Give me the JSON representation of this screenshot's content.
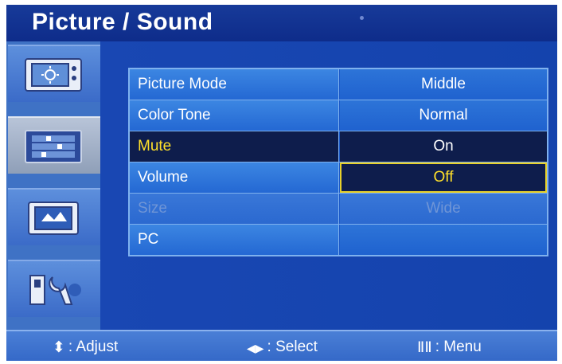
{
  "title": "Picture / Sound",
  "sidebar": {
    "items": [
      {
        "icon": "picture-icon"
      },
      {
        "icon": "audio-settings-icon"
      },
      {
        "icon": "screen-size-icon"
      },
      {
        "icon": "setup-tools-icon"
      }
    ],
    "selected_index": 1
  },
  "menu": {
    "rows": [
      {
        "label": "Picture Mode",
        "value": "Middle"
      },
      {
        "label": "Color Tone",
        "value": "Normal"
      },
      {
        "label": "Mute",
        "value": "On"
      },
      {
        "label": "Volume",
        "value": "Off"
      },
      {
        "label": "Size",
        "value": "Wide"
      },
      {
        "label": "PC",
        "value": ""
      }
    ]
  },
  "footer": {
    "adjust_label": ": Adjust",
    "select_label": ": Select",
    "menu_label": ": Menu",
    "adjust_glyph": "⬍",
    "select_glyph": "◀▶",
    "menu_glyph": "ⅡⅡ"
  },
  "colors": {
    "background": "#0f2e95",
    "highlight_text": "#ffe02a",
    "focus_border": "#e8d12a",
    "dark_row": "#0e1d4c"
  }
}
